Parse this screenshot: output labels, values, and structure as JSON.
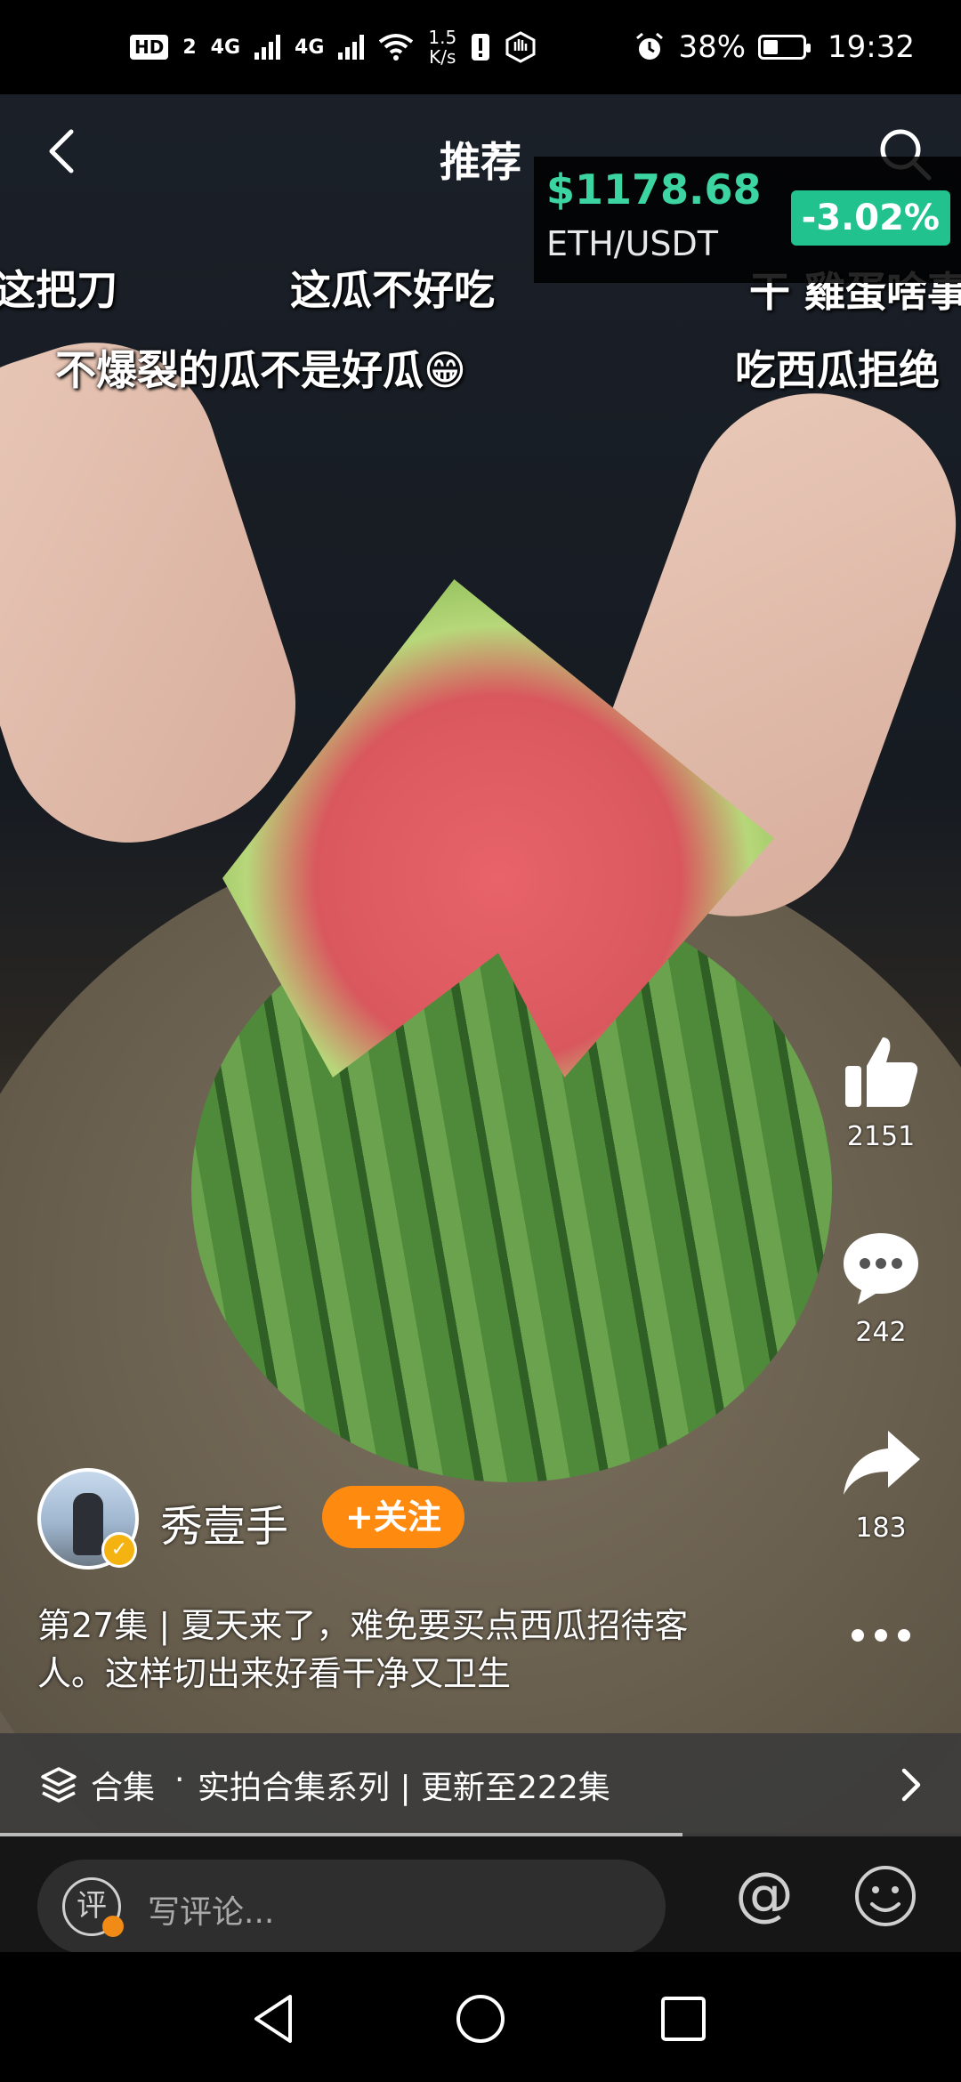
{
  "status_bar": {
    "hd": "HD",
    "sim_slot": "2",
    "net1": "4G",
    "net2": "4G",
    "speed_value": "1.5",
    "speed_unit": "K/s",
    "battery": "38%",
    "battery_level": 0.38,
    "time": "19:32"
  },
  "header": {
    "title": "推荐"
  },
  "ticker": {
    "price": "$1178.68",
    "pair": "ETH/USDT",
    "change": "-3.02%"
  },
  "danmaku": [
    "这把刀",
    "这瓜不好吃",
    "不爆裂的瓜不是好瓜😁",
    "吃西瓜拒绝",
    "干 雞蛋啥事"
  ],
  "actions": {
    "likes": "2151",
    "comments": "242",
    "shares": "183"
  },
  "author": {
    "name": "秀壹手",
    "follow_label": "+关注"
  },
  "caption": "第27集 | 夏天来了，难免要买点西瓜招待客人。这样切出来好看干净又卫生",
  "collection": {
    "label": "合集",
    "separator": "·",
    "series": "实拍合集系列 | 更新至222集"
  },
  "playback_progress": 0.71,
  "comment_bar": {
    "badge": "评",
    "placeholder": "写评论..."
  },
  "colors": {
    "ticker_price": "#3cd4a0",
    "ticker_change_bg": "#22c28f",
    "follow_button": "#ff8a10",
    "verified_badge": "#f4b311"
  }
}
